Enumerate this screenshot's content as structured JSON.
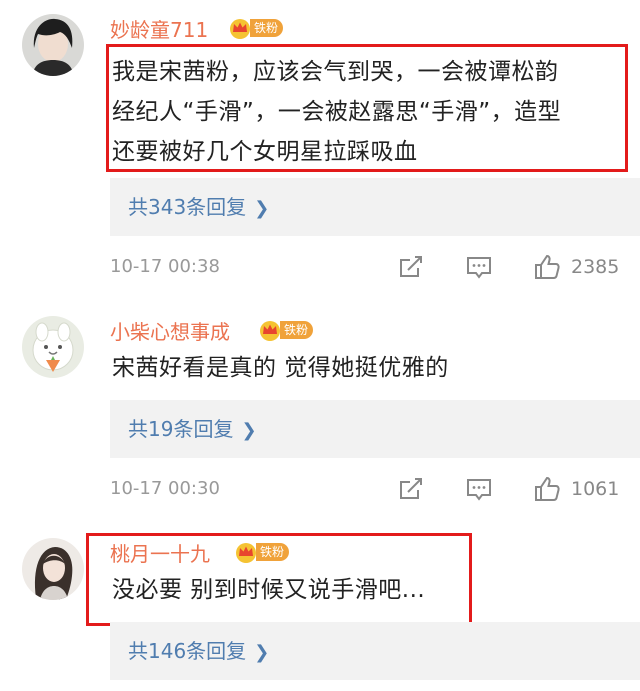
{
  "comments": [
    {
      "username": "妙龄童711",
      "badge": "铁粉",
      "content_lines": [
        "我是宋茜粉，应该会气到哭，一会被谭松韵",
        "经纪人“手滑”，一会被赵露思“手滑”，造型",
        "还要被好几个女明星拉踩吸血"
      ],
      "replies": "共343条回复",
      "time": "10-17 00:38",
      "likes": "2385"
    },
    {
      "username": "小柴心想事成",
      "badge": "铁粉",
      "content_lines": [
        "宋茜好看是真的 觉得她挺优雅的"
      ],
      "replies": "共19条回复",
      "time": "10-17 00:30",
      "likes": "1061"
    },
    {
      "username": "桃月一十九",
      "badge": "铁粉",
      "content_lines": [
        "没必要 别到时候又说手滑吧..."
      ],
      "replies": "共146条回复"
    }
  ],
  "icons": {
    "share": "share-icon",
    "comment": "comment-icon",
    "like": "thumbs-up-icon",
    "crown": "crown-icon",
    "chevron": "chevron-right-icon"
  },
  "colors": {
    "username": "#eb7350",
    "link": "#507daf",
    "highlight_box": "#e31b1b",
    "badge": "#f0a23a"
  }
}
